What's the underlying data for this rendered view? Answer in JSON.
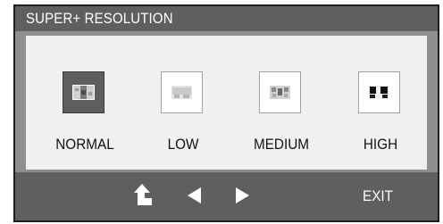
{
  "menu": {
    "title": "SUPER+ RESOLUTION",
    "options": [
      {
        "label": "NORMAL",
        "selected": true,
        "icon": "normal-icon"
      },
      {
        "label": "LOW",
        "selected": false,
        "icon": "low-icon"
      },
      {
        "label": "MEDIUM",
        "selected": false,
        "icon": "medium-icon"
      },
      {
        "label": "HIGH",
        "selected": false,
        "icon": "high-icon"
      }
    ]
  },
  "footer": {
    "icons": [
      "back-icon",
      "left-arrow-icon",
      "right-arrow-icon"
    ],
    "exit_label": "EXIT"
  }
}
